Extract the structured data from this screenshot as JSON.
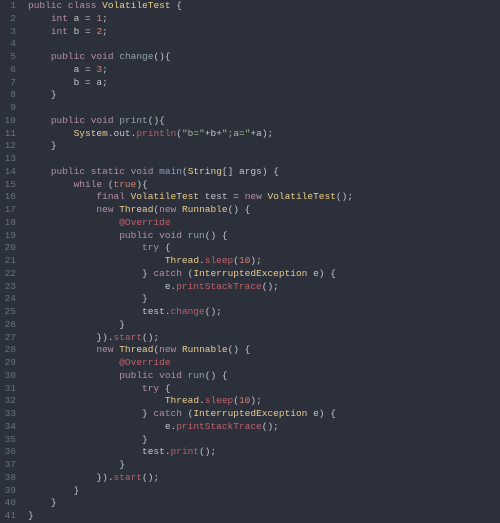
{
  "lineCount": 41,
  "tokens": {
    "kw_public": "public",
    "kw_class": "class",
    "kw_void": "void",
    "kw_int": "int",
    "kw_static": "static",
    "kw_while": "while",
    "kw_final": "final",
    "kw_new": "new",
    "kw_try": "try",
    "kw_catch": "catch",
    "cls_VolatileTest": "VolatileTest",
    "cls_String": "String",
    "cls_Thread": "Thread",
    "cls_Runnable": "Runnable",
    "cls_InterruptedException": "InterruptedException",
    "cls_System": "System",
    "cls_out": "out",
    "ann_Override": "@Override",
    "fld_a": "a",
    "fld_b": "b",
    "var_test": "test",
    "var_args": "args",
    "var_e": "e",
    "m_change": "change",
    "m_print": "print",
    "m_main": "main",
    "m_run": "run",
    "m_start": "start",
    "m_sleep": "sleep",
    "m_printStackTrace": "printStackTrace",
    "m_println": "println",
    "n_1": "1",
    "n_2": "2",
    "n_3": "3",
    "n_10": "10",
    "lit_true": "true",
    "s_b": "\"b=\"",
    "s_a": "\";a=\"",
    "p_obrace": "{",
    "p_cbrace": "}",
    "p_oparen": "(",
    "p_cparen": ")",
    "p_obrack": "[",
    "p_cbrack": "]",
    "p_semi": ";",
    "p_eq": " = ",
    "p_dot": ".",
    "p_plus": "+",
    "p_comma": ", ",
    "p_cparen_ob": ") {",
    "p_cb_dot": "})."
  },
  "chart_data": null
}
